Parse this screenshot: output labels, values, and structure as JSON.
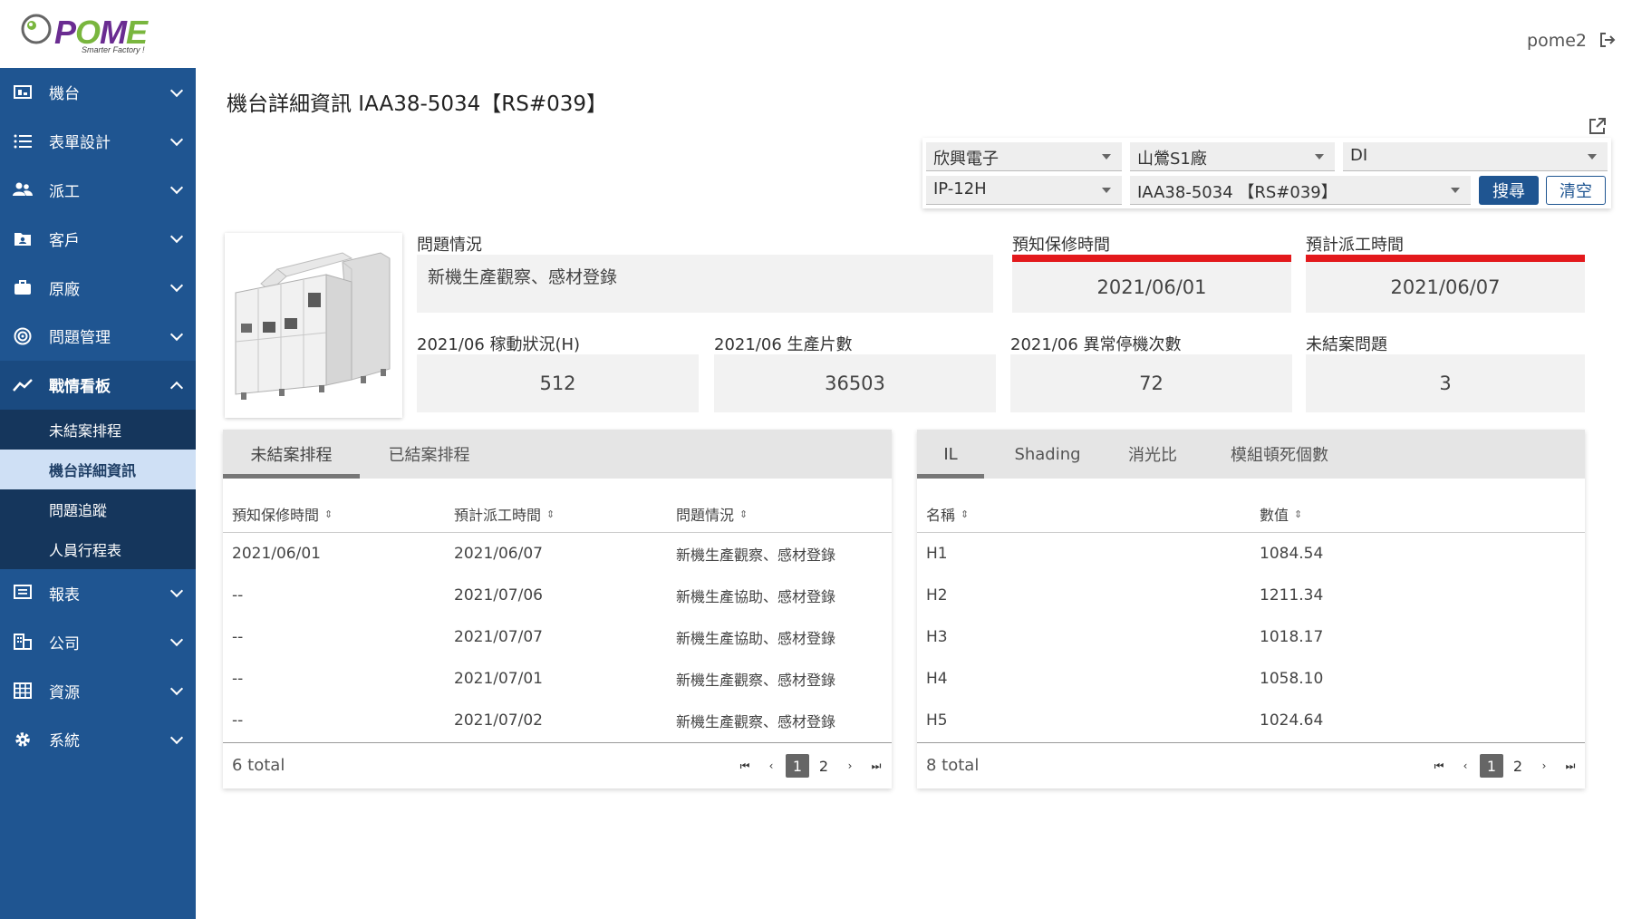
{
  "brand": {
    "logo_text_1": "P",
    "logo_text_2": "O",
    "logo_text_3": "M",
    "logo_text_4": "E",
    "tagline": "Smarter Factory !"
  },
  "header": {
    "username": "pome2"
  },
  "sidebar": {
    "items": [
      {
        "label": "機台",
        "icon": "machine-icon"
      },
      {
        "label": "表單設計",
        "icon": "list-icon"
      },
      {
        "label": "派工",
        "icon": "people-icon"
      },
      {
        "label": "客戶",
        "icon": "folder-user-icon"
      },
      {
        "label": "原廠",
        "icon": "briefcase-icon"
      },
      {
        "label": "問題管理",
        "icon": "spiral-icon"
      },
      {
        "label": "戰情看板",
        "icon": "trend-icon"
      },
      {
        "label": "報表",
        "icon": "report-icon"
      },
      {
        "label": "公司",
        "icon": "building-icon"
      },
      {
        "label": "資源",
        "icon": "grid-icon"
      },
      {
        "label": "系統",
        "icon": "gear-icon"
      }
    ],
    "sub_items": [
      "未結案排程",
      "機台詳細資訊",
      "問題追蹤",
      "人員行程表"
    ]
  },
  "page": {
    "title": "機台詳細資訊 IAA38-5034【RS#039】"
  },
  "filters": {
    "company": "欣興電子",
    "factory": "山鶯S1廠",
    "dept": "DI",
    "model": "IP-12H",
    "machine": "IAA38-5034 【RS#039】",
    "search_label": "搜尋",
    "clear_label": "清空"
  },
  "info": {
    "issue_label": "問題情況",
    "issue_value": "新機生產觀察、感材登錄",
    "warranty_label": "預知保修時間",
    "warranty_value": "2021/06/01",
    "dispatch_label": "預計派工時間",
    "dispatch_value": "2021/06/07",
    "uptime_label": "2021/06 稼動狀況(H)",
    "uptime_value": "512",
    "output_label": "2021/06 生產片數",
    "output_value": "36503",
    "stops_label": "2021/06 異常停機次數",
    "stops_value": "72",
    "open_label": "未結案問題",
    "open_value": "3"
  },
  "left_table": {
    "tabs": [
      "未結案排程",
      "已結案排程"
    ],
    "headers": [
      "預知保修時間",
      "預計派工時間",
      "問題情況"
    ],
    "rows": [
      [
        "2021/06/01",
        "2021/06/07",
        "新機生產觀察、感材登錄"
      ],
      [
        "--",
        "2021/07/06",
        "新機生產協助、感材登錄"
      ],
      [
        "--",
        "2021/07/07",
        "新機生產協助、感材登錄"
      ],
      [
        "--",
        "2021/07/01",
        "新機生產觀察、感材登錄"
      ],
      [
        "--",
        "2021/07/02",
        "新機生產觀察、感材登錄"
      ]
    ],
    "total": "6 total",
    "pages": [
      "1",
      "2"
    ]
  },
  "right_table": {
    "tabs": [
      "IL",
      "Shading",
      "消光比",
      "模組頓死個數"
    ],
    "headers": [
      "名稱",
      "數值"
    ],
    "rows": [
      [
        "H1",
        "1084.54"
      ],
      [
        "H2",
        "1211.34"
      ],
      [
        "H3",
        "1018.17"
      ],
      [
        "H4",
        "1058.10"
      ],
      [
        "H5",
        "1024.64"
      ]
    ],
    "total": "8 total",
    "pages": [
      "1",
      "2"
    ]
  }
}
